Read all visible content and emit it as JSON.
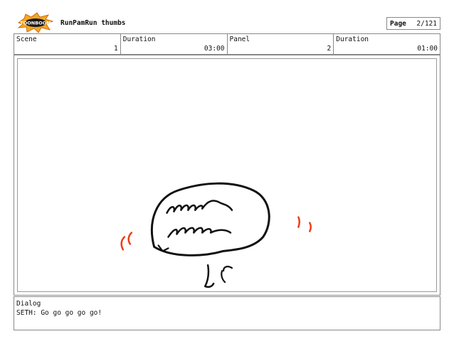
{
  "header": {
    "logo": {
      "text": "TOONBOOM",
      "icon": "toonboom-logo-icon",
      "color": "#f5a623"
    },
    "title": "RunPamRun thumbs",
    "page_label": "Page",
    "page_value": "2/121"
  },
  "info": {
    "scene_label": "Scene",
    "scene_value": "1",
    "duration1_label": "Duration",
    "duration1_value": "03:00",
    "panel_label": "Panel",
    "panel_value": "2",
    "duration2_label": "Duration",
    "duration2_value": "01:00"
  },
  "panel": {
    "sketch_icon": "thought-bubble-sketch-icon",
    "stroke_color": "#111111",
    "accent_color": "#e8401c"
  },
  "dialog": {
    "label": "Dialog",
    "text": "SETH: Go go go go go!"
  }
}
